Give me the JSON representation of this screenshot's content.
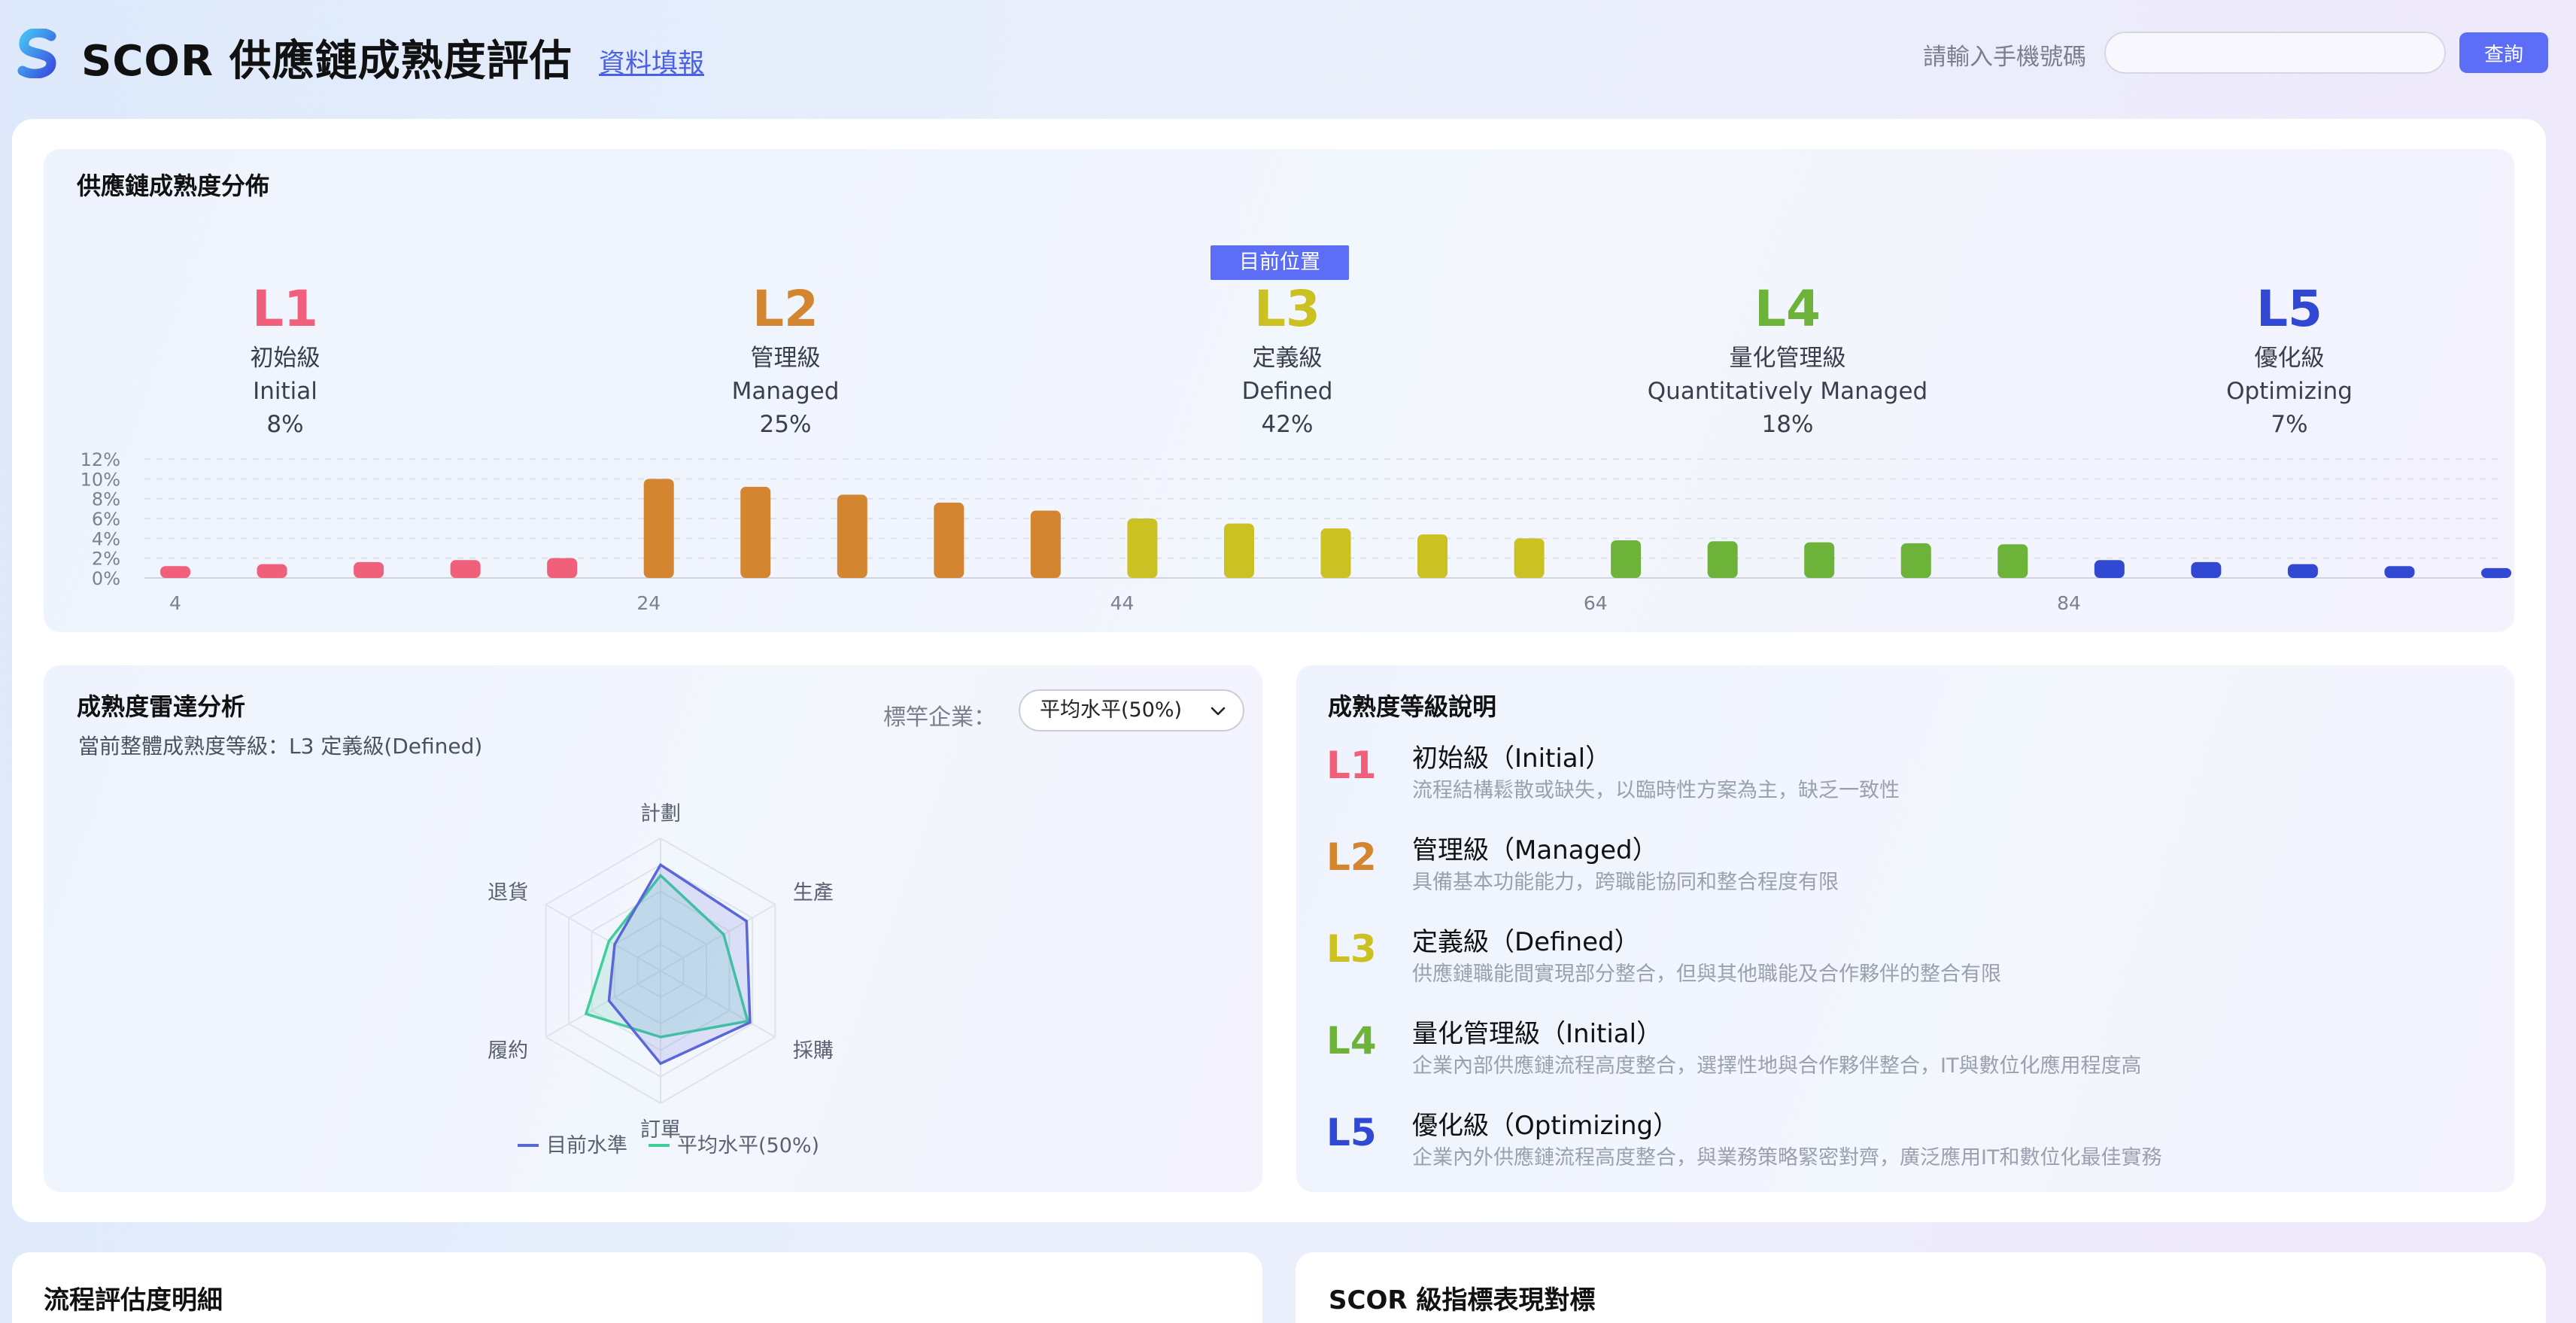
{
  "header": {
    "title": "SCOR 供應鏈成熟度評估",
    "nav_link": "資料填報",
    "phone_label": "請輸入手機號碼",
    "phone_value": "",
    "query_button": "查詢"
  },
  "distribution": {
    "title": "供應鏈成熟度分佈",
    "current_badge": "目前位置",
    "levels": [
      {
        "code": "L1",
        "zh": "初始級",
        "en": "Initial",
        "pct": "8%",
        "color": "#f0607a"
      },
      {
        "code": "L2",
        "zh": "管理級",
        "en": "Managed",
        "pct": "25%",
        "color": "#d3852f"
      },
      {
        "code": "L3",
        "zh": "定義級",
        "en": "Defined",
        "pct": "42%",
        "color": "#cbc123"
      },
      {
        "code": "L4",
        "zh": "量化管理級",
        "en": "Quantitatively Managed",
        "pct": "18%",
        "color": "#6db33a"
      },
      {
        "code": "L5",
        "zh": "優化級",
        "en": "Optimizing",
        "pct": "7%",
        "color": "#3048d2"
      }
    ]
  },
  "chart_data": {
    "type": "bar",
    "x": [
      4,
      9,
      14,
      19,
      24,
      29,
      34,
      39,
      44,
      49,
      54,
      59,
      64,
      69,
      74,
      79,
      84,
      89,
      94,
      99
    ],
    "values": [
      1.2,
      1.4,
      1.6,
      1.8,
      2.0,
      10.0,
      9.2,
      8.4,
      7.6,
      6.8,
      6.0,
      5.5,
      5.0,
      4.4,
      4.0,
      3.8,
      3.7,
      3.6,
      3.5,
      3.4,
      1.8,
      1.6,
      1.4,
      1.2,
      1.0
    ],
    "categories": [
      "L1",
      "L1",
      "L1",
      "L1",
      "L1",
      "L2",
      "L2",
      "L2",
      "L2",
      "L2",
      "L3",
      "L3",
      "L3",
      "L3",
      "L3",
      "L4",
      "L4",
      "L4",
      "L4",
      "L4",
      "L5",
      "L5",
      "L5",
      "L5",
      "L5"
    ],
    "x_ticks": [
      4,
      24,
      44,
      64,
      84
    ],
    "y_ticks": [
      "0%",
      "2%",
      "4%",
      "6%",
      "8%",
      "10%",
      "12%"
    ],
    "ylim": [
      0,
      12
    ]
  },
  "radar": {
    "title": "成熟度雷達分析",
    "subtitle": "當前整體成熟度等級：L3 定義級(Defined)",
    "bench_label": "標竿企業：",
    "bench_value": "平均水平(50%)",
    "axes": [
      "計劃",
      "生產",
      "採購",
      "訂單",
      "履約",
      "退貨"
    ],
    "series": [
      {
        "name": "目前水準",
        "color": "#5a67d8",
        "values": [
          0.8,
          0.75,
          0.78,
          0.7,
          0.45,
          0.4
        ]
      },
      {
        "name": "平均水平(50%)",
        "color": "#3ecf9a",
        "values": [
          0.72,
          0.55,
          0.76,
          0.5,
          0.65,
          0.45
        ]
      }
    ]
  },
  "level_desc": {
    "title": "成熟度等級說明",
    "items": [
      {
        "code": "L1",
        "title": "初始級（Initial）",
        "desc": "流程結構鬆散或缺失，以臨時性方案為主，缺乏一致性",
        "color": "#f0607a"
      },
      {
        "code": "L2",
        "title": "管理級（Managed）",
        "desc": "具備基本功能能力，跨職能協同和整合程度有限",
        "color": "#d3852f"
      },
      {
        "code": "L3",
        "title": "定義級（Defined）",
        "desc": "供應鏈職能間實現部分整合，但與其他職能及合作夥伴的整合有限",
        "color": "#cbc123"
      },
      {
        "code": "L4",
        "title": "量化管理級（Initial）",
        "desc": "企業內部供應鏈流程高度整合，選擇性地與合作夥伴整合，IT與數位化應用程度高",
        "color": "#6db33a"
      },
      {
        "code": "L5",
        "title": "優化級（Optimizing）",
        "desc": "企業內外供應鏈流程高度整合，與業務策略緊密對齊，廣泛應用IT和數位化最佳實務",
        "color": "#3048d2"
      }
    ]
  },
  "bottom": {
    "left_title": "流程評估度明細",
    "right_title": "SCOR 級指標表現對標"
  }
}
